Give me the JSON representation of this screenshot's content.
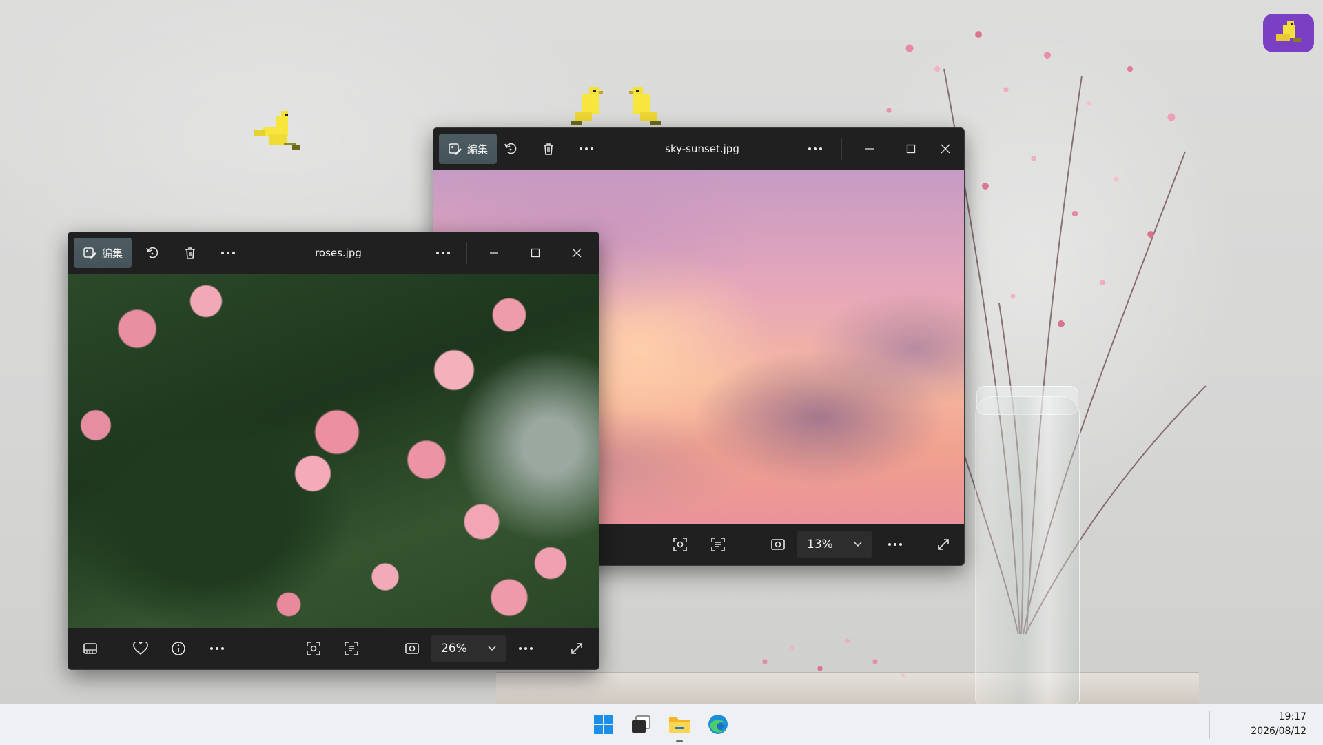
{
  "windows": [
    {
      "id": "sky",
      "title": "sky-sunset.jpg",
      "edit_label": "編集",
      "zoom": "13%"
    },
    {
      "id": "roses",
      "title": "roses.jpg",
      "edit_label": "編集",
      "zoom": "26%"
    }
  ],
  "taskbar": {
    "apps": [
      "windows-start",
      "task-view",
      "file-explorer",
      "edge-browser"
    ],
    "time": "19:17",
    "date": "2026/08/12"
  },
  "colors": {
    "window_bg": "#202020",
    "edit_button": "#45535a",
    "taskbar_bg": "#eef0f3",
    "accent": "#0078d4"
  }
}
